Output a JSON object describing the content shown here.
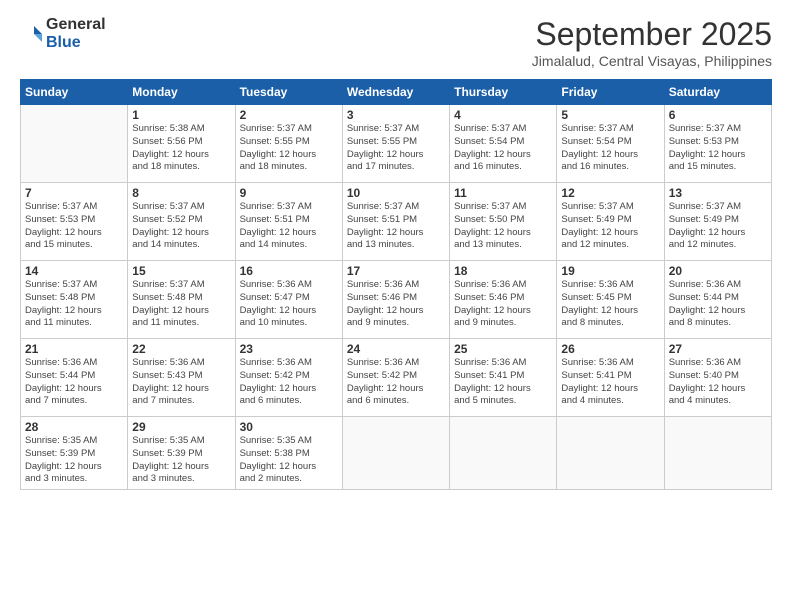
{
  "logo": {
    "general": "General",
    "blue": "Blue"
  },
  "header": {
    "month": "September 2025",
    "location": "Jimalalud, Central Visayas, Philippines"
  },
  "weekdays": [
    "Sunday",
    "Monday",
    "Tuesday",
    "Wednesday",
    "Thursday",
    "Friday",
    "Saturday"
  ],
  "weeks": [
    [
      {
        "day": "",
        "info": ""
      },
      {
        "day": "1",
        "info": "Sunrise: 5:38 AM\nSunset: 5:56 PM\nDaylight: 12 hours\nand 18 minutes."
      },
      {
        "day": "2",
        "info": "Sunrise: 5:37 AM\nSunset: 5:55 PM\nDaylight: 12 hours\nand 18 minutes."
      },
      {
        "day": "3",
        "info": "Sunrise: 5:37 AM\nSunset: 5:55 PM\nDaylight: 12 hours\nand 17 minutes."
      },
      {
        "day": "4",
        "info": "Sunrise: 5:37 AM\nSunset: 5:54 PM\nDaylight: 12 hours\nand 16 minutes."
      },
      {
        "day": "5",
        "info": "Sunrise: 5:37 AM\nSunset: 5:54 PM\nDaylight: 12 hours\nand 16 minutes."
      },
      {
        "day": "6",
        "info": "Sunrise: 5:37 AM\nSunset: 5:53 PM\nDaylight: 12 hours\nand 15 minutes."
      }
    ],
    [
      {
        "day": "7",
        "info": "Sunrise: 5:37 AM\nSunset: 5:53 PM\nDaylight: 12 hours\nand 15 minutes."
      },
      {
        "day": "8",
        "info": "Sunrise: 5:37 AM\nSunset: 5:52 PM\nDaylight: 12 hours\nand 14 minutes."
      },
      {
        "day": "9",
        "info": "Sunrise: 5:37 AM\nSunset: 5:51 PM\nDaylight: 12 hours\nand 14 minutes."
      },
      {
        "day": "10",
        "info": "Sunrise: 5:37 AM\nSunset: 5:51 PM\nDaylight: 12 hours\nand 13 minutes."
      },
      {
        "day": "11",
        "info": "Sunrise: 5:37 AM\nSunset: 5:50 PM\nDaylight: 12 hours\nand 13 minutes."
      },
      {
        "day": "12",
        "info": "Sunrise: 5:37 AM\nSunset: 5:49 PM\nDaylight: 12 hours\nand 12 minutes."
      },
      {
        "day": "13",
        "info": "Sunrise: 5:37 AM\nSunset: 5:49 PM\nDaylight: 12 hours\nand 12 minutes."
      }
    ],
    [
      {
        "day": "14",
        "info": "Sunrise: 5:37 AM\nSunset: 5:48 PM\nDaylight: 12 hours\nand 11 minutes."
      },
      {
        "day": "15",
        "info": "Sunrise: 5:37 AM\nSunset: 5:48 PM\nDaylight: 12 hours\nand 11 minutes."
      },
      {
        "day": "16",
        "info": "Sunrise: 5:36 AM\nSunset: 5:47 PM\nDaylight: 12 hours\nand 10 minutes."
      },
      {
        "day": "17",
        "info": "Sunrise: 5:36 AM\nSunset: 5:46 PM\nDaylight: 12 hours\nand 9 minutes."
      },
      {
        "day": "18",
        "info": "Sunrise: 5:36 AM\nSunset: 5:46 PM\nDaylight: 12 hours\nand 9 minutes."
      },
      {
        "day": "19",
        "info": "Sunrise: 5:36 AM\nSunset: 5:45 PM\nDaylight: 12 hours\nand 8 minutes."
      },
      {
        "day": "20",
        "info": "Sunrise: 5:36 AM\nSunset: 5:44 PM\nDaylight: 12 hours\nand 8 minutes."
      }
    ],
    [
      {
        "day": "21",
        "info": "Sunrise: 5:36 AM\nSunset: 5:44 PM\nDaylight: 12 hours\nand 7 minutes."
      },
      {
        "day": "22",
        "info": "Sunrise: 5:36 AM\nSunset: 5:43 PM\nDaylight: 12 hours\nand 7 minutes."
      },
      {
        "day": "23",
        "info": "Sunrise: 5:36 AM\nSunset: 5:42 PM\nDaylight: 12 hours\nand 6 minutes."
      },
      {
        "day": "24",
        "info": "Sunrise: 5:36 AM\nSunset: 5:42 PM\nDaylight: 12 hours\nand 6 minutes."
      },
      {
        "day": "25",
        "info": "Sunrise: 5:36 AM\nSunset: 5:41 PM\nDaylight: 12 hours\nand 5 minutes."
      },
      {
        "day": "26",
        "info": "Sunrise: 5:36 AM\nSunset: 5:41 PM\nDaylight: 12 hours\nand 4 minutes."
      },
      {
        "day": "27",
        "info": "Sunrise: 5:36 AM\nSunset: 5:40 PM\nDaylight: 12 hours\nand 4 minutes."
      }
    ],
    [
      {
        "day": "28",
        "info": "Sunrise: 5:35 AM\nSunset: 5:39 PM\nDaylight: 12 hours\nand 3 minutes."
      },
      {
        "day": "29",
        "info": "Sunrise: 5:35 AM\nSunset: 5:39 PM\nDaylight: 12 hours\nand 3 minutes."
      },
      {
        "day": "30",
        "info": "Sunrise: 5:35 AM\nSunset: 5:38 PM\nDaylight: 12 hours\nand 2 minutes."
      },
      {
        "day": "",
        "info": ""
      },
      {
        "day": "",
        "info": ""
      },
      {
        "day": "",
        "info": ""
      },
      {
        "day": "",
        "info": ""
      }
    ]
  ]
}
